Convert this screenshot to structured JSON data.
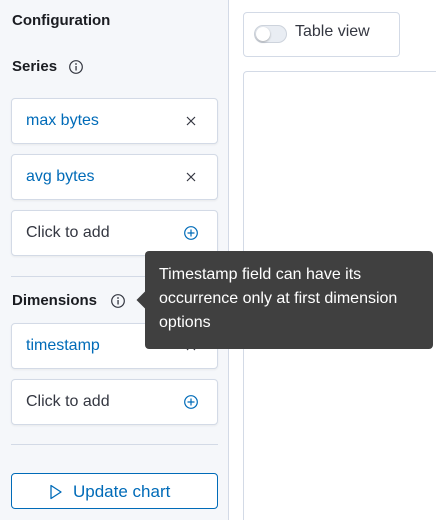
{
  "sidebar": {
    "title": "Configuration",
    "series": {
      "heading": "Series",
      "items": [
        {
          "label": "max bytes"
        },
        {
          "label": "avg bytes"
        }
      ],
      "add_label": "Click to add"
    },
    "dimensions": {
      "heading": "Dimensions",
      "items": [
        {
          "label": "timestamp"
        }
      ],
      "add_label": "Click to add"
    },
    "update_button_label": "Update chart"
  },
  "main": {
    "table_view": {
      "label": "Table view",
      "checked": false
    }
  },
  "tooltip": {
    "text": "Timestamp field can have its occurrence only at first dimension options"
  },
  "colors": {
    "accent": "#006bb8",
    "tooltip_bg": "#404040",
    "border": "#d3dae6",
    "sidebar_bg": "#f5f7fa"
  }
}
